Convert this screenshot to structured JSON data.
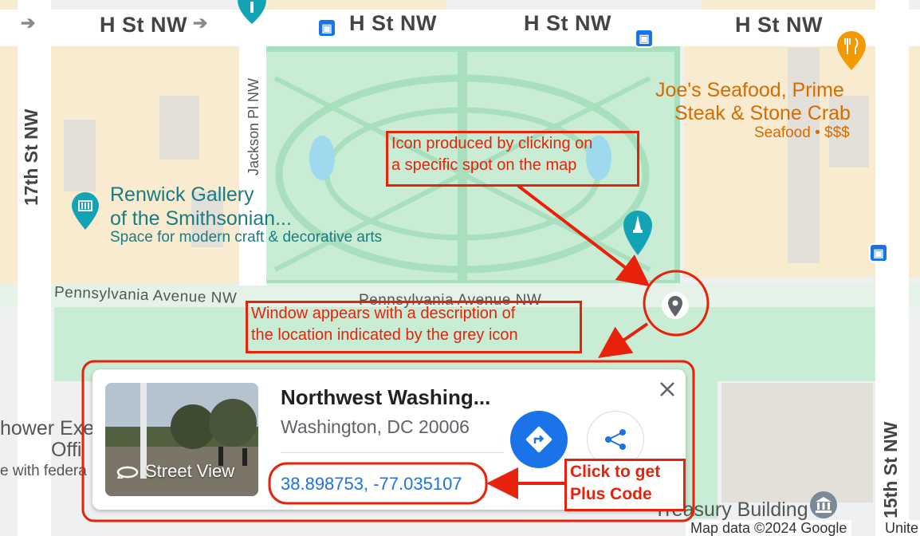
{
  "map": {
    "streets": {
      "h_st_1": "H St NW",
      "h_st_2": "H St NW",
      "h_st_3": "H St NW",
      "h_st_4": "H St NW",
      "seventeenth": "17th St NW",
      "jackson": "Jackson Pl NW",
      "penn_1": "Pennsylvania Avenue NW",
      "penn_2": "Pennsylvania Avenue NW",
      "fifteenth": "15th St NW"
    },
    "pois": {
      "renwick_title_1": "Renwick Gallery",
      "renwick_title_2": "of the Smithsonian...",
      "renwick_sub": "Space for modern craft & decorative arts",
      "joes_title_1": "Joe's Seafood, Prime",
      "joes_title_2": "Steak & Stone Crab",
      "joes_sub": "Seafood • $$$",
      "eisenhower_1": "hower Exe",
      "eisenhower_2": "Offi",
      "eisenhower_sub": "e with federa",
      "treasury": "Treasury Building"
    },
    "attribution": "Map data ©2024 Google",
    "attribution_right": "Unite"
  },
  "annotations": {
    "icon_note_1": "Icon produced by clicking on",
    "icon_note_2": "a specific spot on the map",
    "window_note_1": "Window appears with a description of",
    "window_note_2": "the location indicated by the grey icon",
    "plus_note_1": "Click to get",
    "plus_note_2": "Plus Code"
  },
  "card": {
    "street_view_label": "Street View",
    "title": "Northwest Washing...",
    "address": "Washington, DC 20006",
    "coordinates": "38.898753, -77.035107"
  },
  "colors": {
    "accent": "#1a73e8",
    "annotation": "#e8210a",
    "park": "#c8ecd4",
    "poi_teal": "#1a7c84",
    "food_orange": "#d86b00"
  }
}
